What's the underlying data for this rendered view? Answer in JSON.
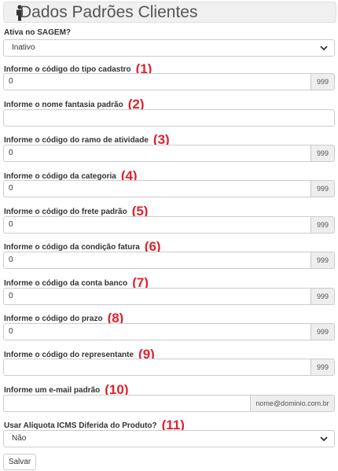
{
  "header": {
    "title": "Dados Padrões Clientes",
    "icon": "person-icon"
  },
  "fields": {
    "ativo": {
      "label": "Ativa no SAGEM?",
      "value": "Inativo"
    },
    "tipo_cadastro": {
      "label": "Informe o código do tipo cadastro",
      "marker": "(1)",
      "value": "0",
      "addon": "999"
    },
    "nome_fantasia": {
      "label": "Informe o nome fantasia padrão",
      "marker": "(2)",
      "value": ""
    },
    "ramo_atividade": {
      "label": "Informe o código do ramo de atividade",
      "marker": "(3)",
      "value": "0",
      "addon": "999"
    },
    "categoria": {
      "label": "Informe o código da categoria",
      "marker": "(4)",
      "value": "0",
      "addon": "999"
    },
    "frete": {
      "label": "Informe o código do frete padrão",
      "marker": "(5)",
      "value": "0",
      "addon": "999"
    },
    "condicao_fatura": {
      "label": "Informe o código da condição fatura",
      "marker": "(6)",
      "value": "0",
      "addon": "999"
    },
    "conta_banco": {
      "label": "Informe o código da conta banco",
      "marker": "(7)",
      "value": "0",
      "addon": "999"
    },
    "prazo": {
      "label": "Informe o código do prazo",
      "marker": "(8)",
      "value": "0",
      "addon": "999"
    },
    "representante": {
      "label": "Informe o código do representante",
      "marker": "(9)",
      "value": "",
      "addon": "999"
    },
    "email": {
      "label": "Informe um e-mail padrão",
      "marker": "(10)",
      "value": "",
      "addon": "nome@dominio.com.br"
    },
    "icms": {
      "label": "Usar Alíquota ICMS Diferida do Produto?",
      "marker": "(11)",
      "value": "Não"
    }
  },
  "actions": {
    "save_label": "Salvar"
  },
  "colors": {
    "marker": "#e0212d",
    "addon_bg": "#eeeeee",
    "border": "#cccccc"
  }
}
